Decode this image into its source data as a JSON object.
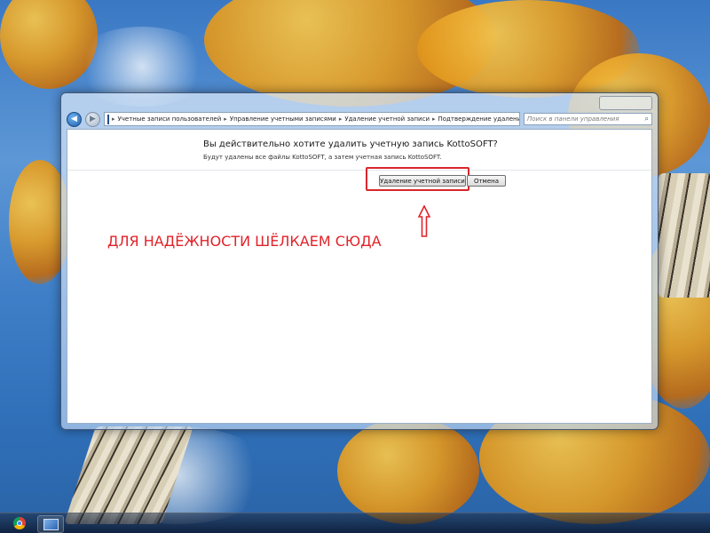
{
  "window": {
    "breadcrumb": [
      "Учетные записи пользователей",
      "Управление учетными записями",
      "Удаление учетной записи",
      "Подтверждение удаления"
    ],
    "search_placeholder": "Поиск в панели управления"
  },
  "dialog": {
    "question": "Вы действительно хотите удалить учетную запись KottoSOFT?",
    "description": "Будут удалены все файлы KottoSOFT, а затем учетная запись KottoSOFT.",
    "delete_button": "Удаление учетной записи",
    "cancel_button": "Отмена"
  },
  "annotation": {
    "text": "ДЛЯ НАДЁЖНОСТИ ШЁЛКАЕМ СЮДА",
    "color": "#e1232a"
  },
  "taskbar": {
    "items": [
      "chrome-icon",
      "explorer-icon"
    ]
  },
  "icons": {
    "back": "◀",
    "forward": "▶",
    "separator": "▸",
    "refresh": "⟲",
    "search": "⌕",
    "dropdown": "▾"
  }
}
